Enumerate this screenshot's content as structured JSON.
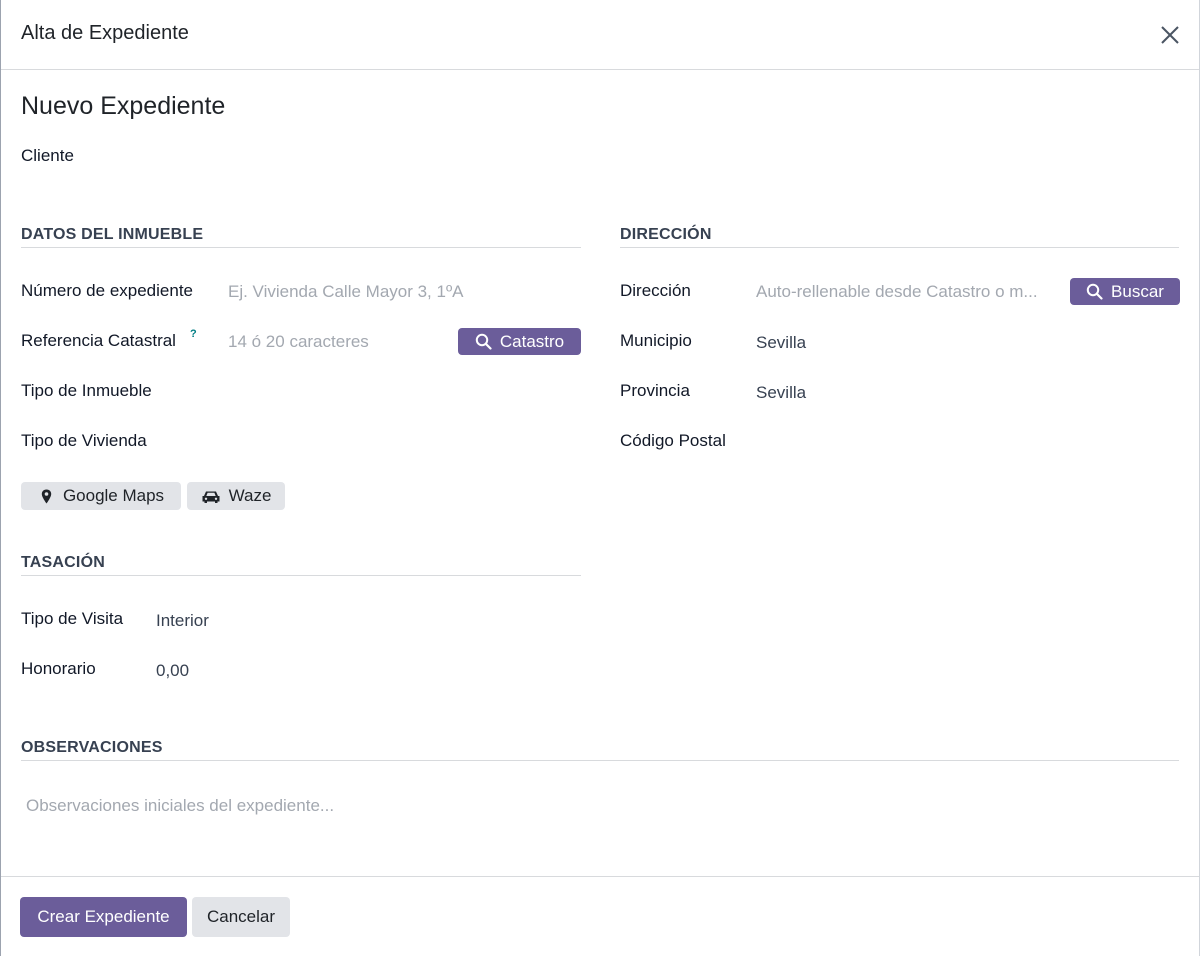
{
  "dialog": {
    "title": "Alta de Expediente",
    "record_title": "Nuevo Expediente",
    "cliente_label": "Cliente"
  },
  "inmueble": {
    "section_title": "DATOS DEL INMUEBLE",
    "numero_label": "Número de expediente",
    "numero_placeholder": "Ej. Vivienda Calle Mayor 3, 1ºA",
    "numero_value": "",
    "ref_label": "Referencia Catastral",
    "ref_help": "?",
    "ref_placeholder": "14 ó 20 caracteres",
    "ref_value": "",
    "catastro_button": "Catastro",
    "tipo_inmueble_label": "Tipo de Inmueble",
    "tipo_vivienda_label": "Tipo de Vivienda",
    "google_maps_button": "Google Maps",
    "waze_button": "Waze"
  },
  "direccion": {
    "section_title": "DIRECCIÓN",
    "direccion_label": "Dirección",
    "direccion_placeholder": "Auto-rellenable desde Catastro o m...",
    "buscar_button": "Buscar",
    "municipio_label": "Municipio",
    "municipio_value": "Sevilla",
    "provincia_label": "Provincia",
    "provincia_value": "Sevilla",
    "cp_label": "Código Postal"
  },
  "tasacion": {
    "section_title": "TASACIÓN",
    "tipo_visita_label": "Tipo de Visita",
    "tipo_visita_value": "Interior",
    "honorario_label": "Honorario",
    "honorario_value": "0,00"
  },
  "observaciones": {
    "section_title": "OBSERVACIONES",
    "placeholder": "Observaciones iniciales del expediente..."
  },
  "footer": {
    "create_button": "Crear Expediente",
    "cancel_button": "Cancelar"
  },
  "colors": {
    "primary": "#6b5d9a",
    "secondary": "#e2e4e8",
    "help": "#017e84"
  },
  "icons": {
    "close": "close-icon",
    "search": "search-icon",
    "map_marker": "map-marker-icon",
    "car": "car-icon"
  }
}
